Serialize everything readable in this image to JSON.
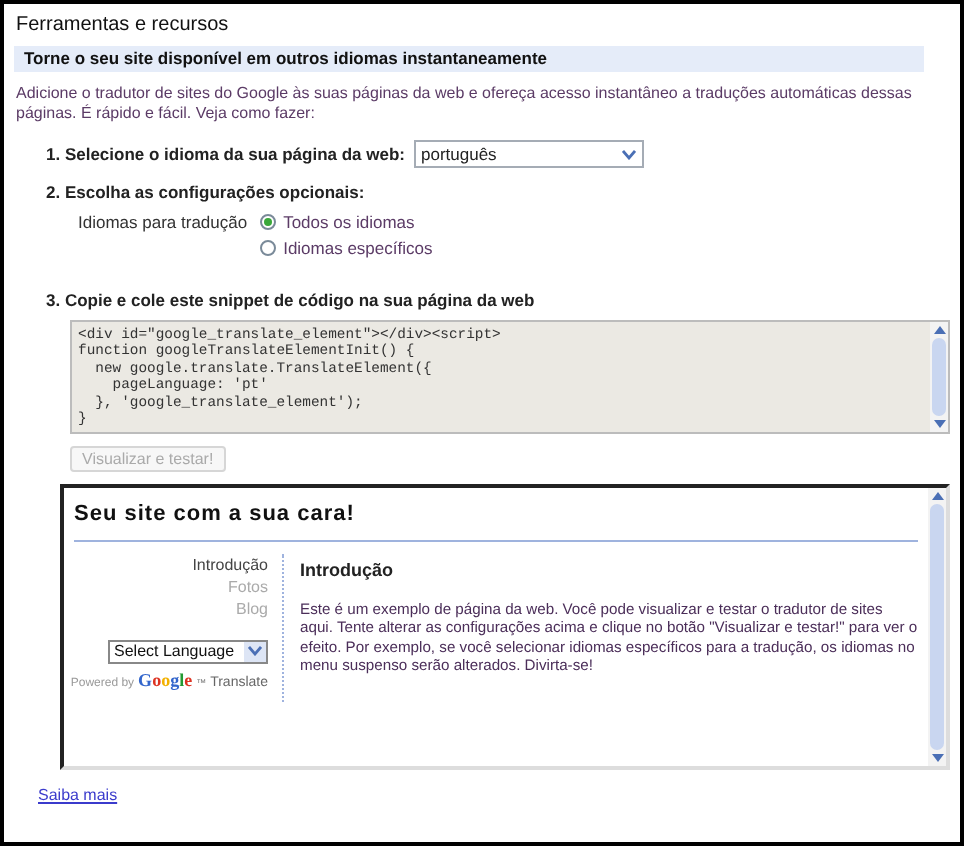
{
  "section_title": "Ferramentas e recursos",
  "banner": "Torne o seu site disponível em outros idiomas instantaneamente",
  "intro": "Adicione o tradutor de sites do Google às suas páginas da web e ofereça acesso instantâneo a traduções automáticas dessas páginas. É rápido e fácil. Veja como fazer:",
  "steps": [
    {
      "kind": "select",
      "label": "1. Selecione o idioma da sua página da web:",
      "value": "português"
    },
    {
      "kind": "options",
      "label": "2. Escolha as configurações opcionais:",
      "option_label": "Idiomas para tradução",
      "options": [
        {
          "label": "Todos os idiomas",
          "selected": true
        },
        {
          "label": "Idiomas específicos",
          "selected": false
        }
      ]
    },
    {
      "kind": "code",
      "label": "3. Copie e cole este snippet de código na sua página da web",
      "code": [
        "<div id=\"google_translate_element\"></div><script>",
        "function googleTranslateElementInit() {",
        "  new google.translate.TranslateElement({",
        "    pageLanguage: 'pt'",
        "  }, 'google_translate_element');",
        "}"
      ]
    }
  ],
  "preview_button": {
    "label": "Visualizar e testar!",
    "disabled": true
  },
  "preview": {
    "site_title": "Seu site com a sua cara!",
    "nav": [
      {
        "label": "Introdução",
        "selected": true
      },
      {
        "label": "Fotos",
        "selected": false
      },
      {
        "label": "Blog",
        "selected": false
      }
    ],
    "language_select": "Select Language",
    "powered_by": "Powered by",
    "google": "Google",
    "tm": "™",
    "translate": "Translate",
    "heading": "Introdução",
    "body": "Este é um exemplo de página da web. Você pode visualizar e testar o tradutor de sites aqui. Tente alterar as configurações acima e clique no botão \"Visualizar e testar!\" para ver o efeito. Por exemplo, se você selecionar idiomas específicos para a tradução, os idiomas no menu suspenso serão alterados. Divirta-se!"
  },
  "link": "Saiba mais"
}
